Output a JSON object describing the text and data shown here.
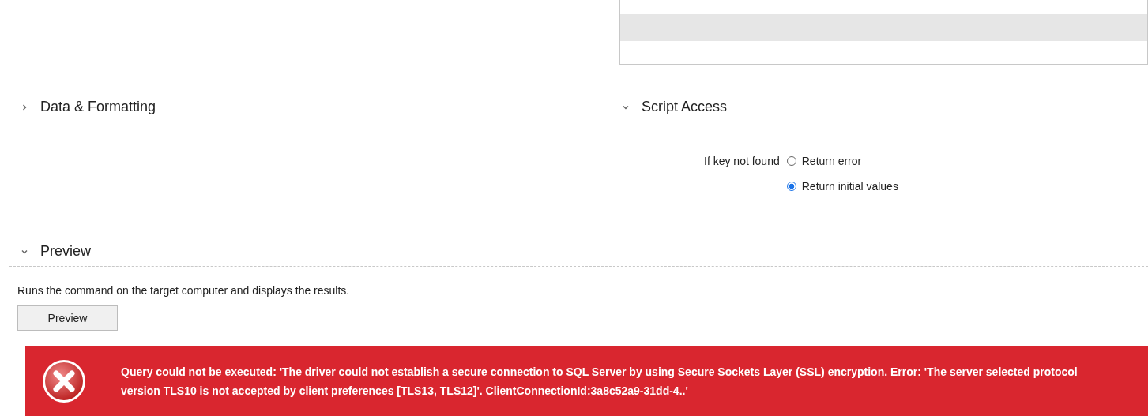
{
  "list_box": {
    "rows": [
      {
        "selected": false
      },
      {
        "selected": true
      },
      {
        "selected": false
      }
    ]
  },
  "sections": [
    {
      "title": "Data & Formatting",
      "expanded": false
    },
    {
      "title": "Script Access",
      "expanded": true,
      "field_label": "If key not found",
      "options": [
        {
          "label": "Return error",
          "selected": false
        },
        {
          "label": "Return initial values",
          "selected": true
        }
      ]
    }
  ],
  "preview": {
    "title": "Preview",
    "expanded": true,
    "description": "Runs the command on the target computer and displays the results.",
    "button": "Preview"
  },
  "error": {
    "message": "Query could not be executed: 'The driver could not establish a secure connection to SQL Server by using Secure Sockets Layer (SSL) encryption. Error: 'The server selected protocol version TLS10 is not accepted by client preferences [TLS13, TLS12]'. ClientConnectionId:3a8c52a9-31dd-4..'"
  }
}
